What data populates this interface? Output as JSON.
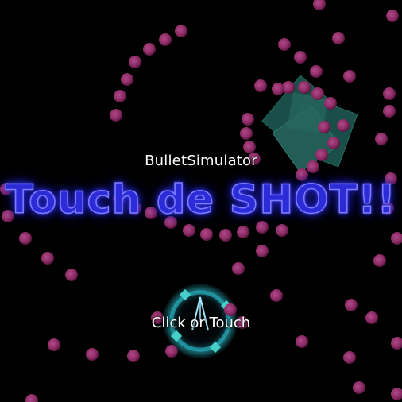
{
  "title_screen": {
    "subtitle": "BulletSimulator",
    "title": "Touch de SHOT!!",
    "prompt": "Click or Touch"
  },
  "colors": {
    "background": "#000000",
    "bullet": "#8a2a63",
    "bullet_highlight": "#b04a8a",
    "title_fill": "#2b2bd8",
    "title_outline": "#7d7dff",
    "enemy_fill": "#1f5c55",
    "player_glow": "#2ec4d6"
  },
  "icons": {
    "enemy": "enemy-boss-icon",
    "player": "player-ship-icon",
    "bullet": "enemy-bullet"
  }
}
